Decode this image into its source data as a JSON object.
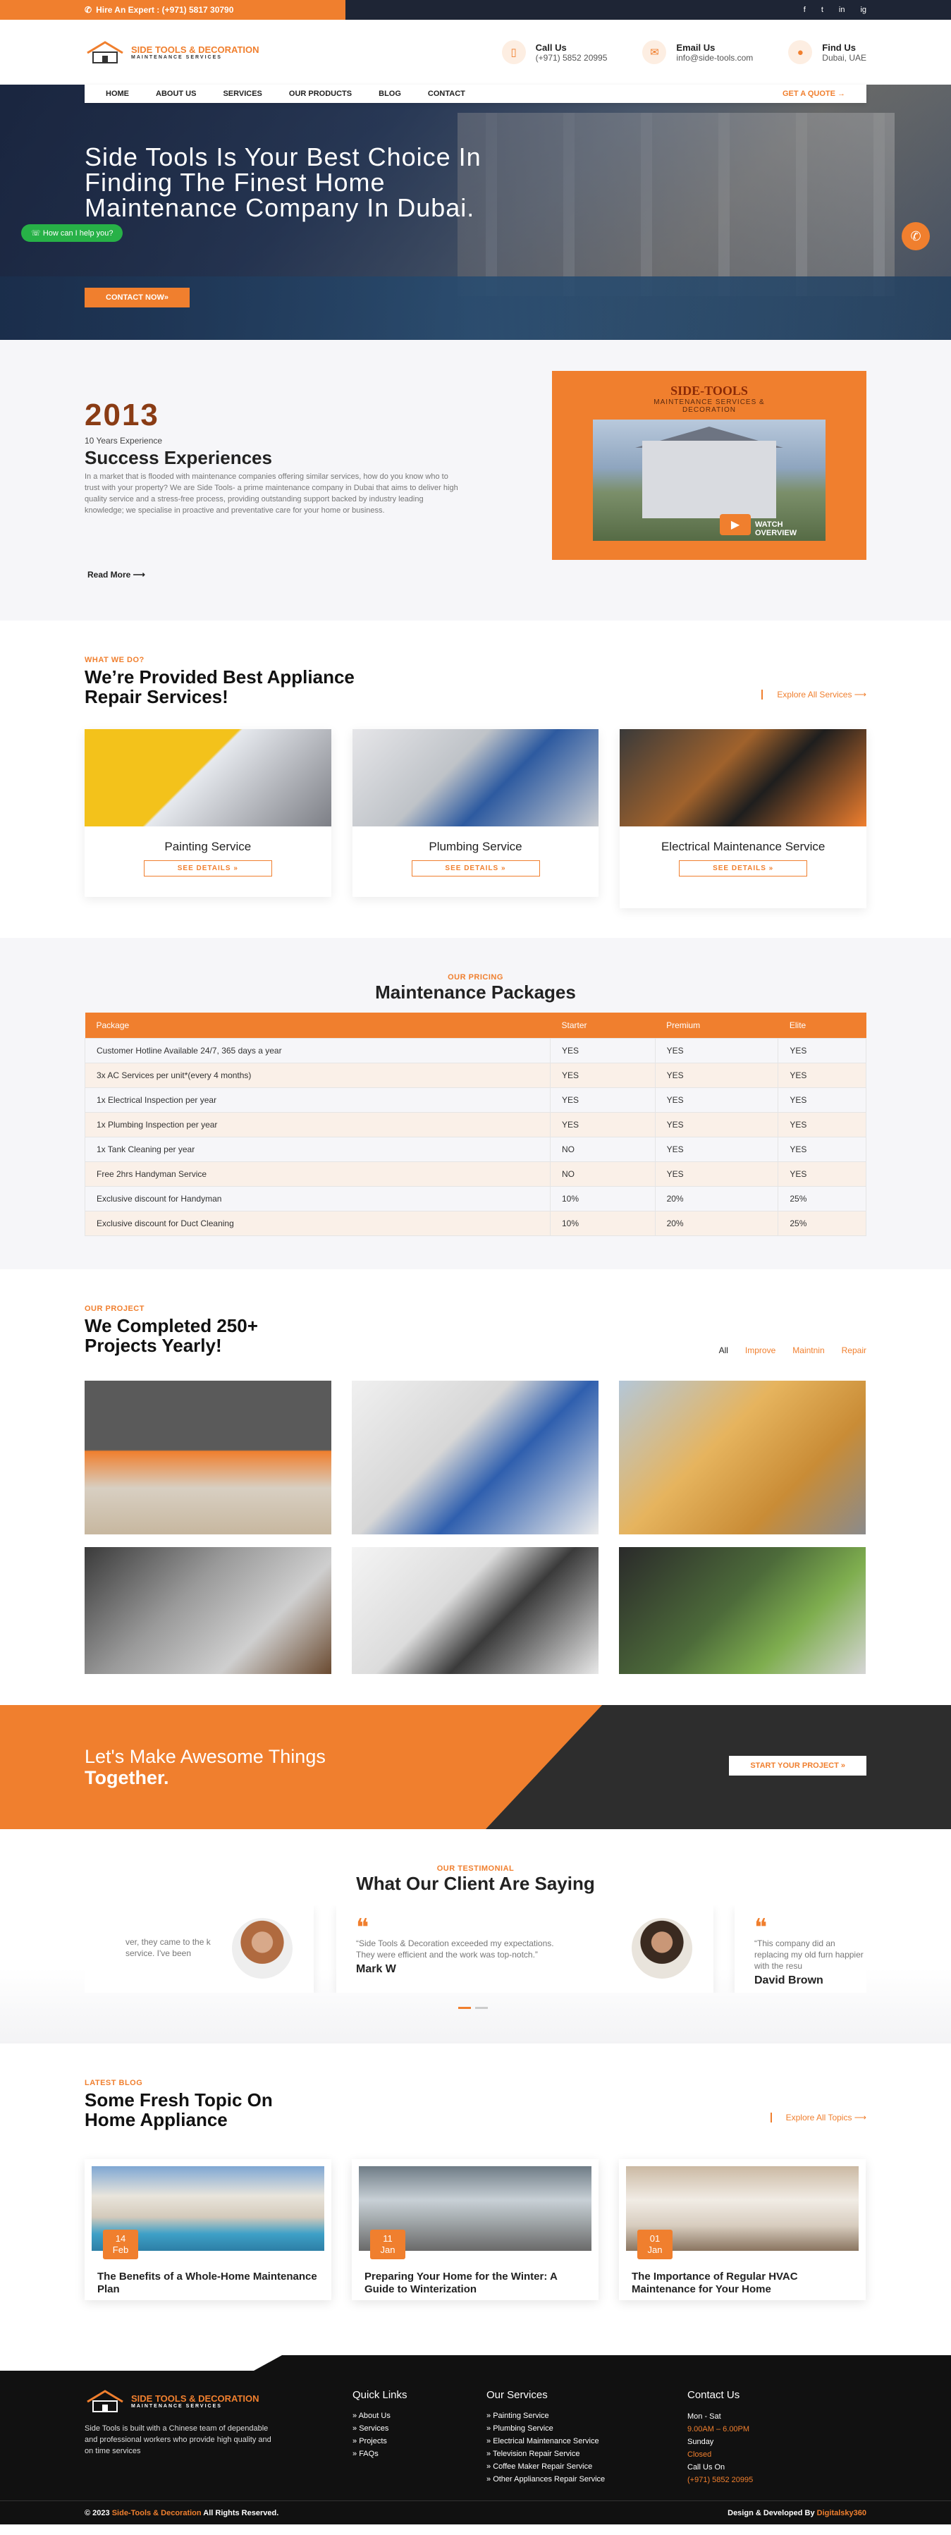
{
  "topbar": {
    "phone_label": "Hire An Expert : (+971) 5817 30790",
    "social": [
      "f",
      "t",
      "in",
      "ig"
    ]
  },
  "header": {
    "logo_title": "SIDE TOOLS & DECORATION",
    "logo_sub": "MAINTENANCE SERVICES",
    "call_title": "Call Us",
    "call_value": "(+971) 5852 20995",
    "email_title": "Email Us",
    "email_value": "info@side-tools.com",
    "find_title": "Find Us",
    "find_value": "Dubai, UAE"
  },
  "nav": {
    "items": [
      "HOME",
      "ABOUT US",
      "SERVICES",
      "OUR PRODUCTS",
      "BLOG",
      "CONTACT"
    ],
    "quote": "GET A QUOTE →"
  },
  "hero": {
    "heading": "Side Tools Is Your Best Choice In Finding The Finest Home Maintenance Company In Dubai.",
    "cta": "CONTACT NOW»",
    "whatsapp": "How can I help you?"
  },
  "about": {
    "year": "2013",
    "exp_label": "10 Years Experience",
    "heading": "Success Experiences",
    "desc": "In a market that is flooded with maintenance companies offering similar services, how do you know who to trust with your property? We are Side Tools- a prime maintenance company in Dubai that aims to deliver high quality service and a stress-free process, providing outstanding support backed by industry leading knowledge; we specialise in proactive and preventative care for your home or business.",
    "read_more": "Read More ⟶",
    "video_title": "SIDE-TOOLS",
    "video_sub": "MAINTENANCE SERVICES & DECORATION",
    "video_btn": "WATCH OVERVIEW"
  },
  "services": {
    "tag": "WHAT WE DO?",
    "heading_line1": "We’re Provided Best Appliance",
    "heading_line2": "Repair Services!",
    "explore": "Explore All Services ⟶",
    "cards": [
      {
        "title": "Painting Service",
        "btn": "SEE DETAILS »"
      },
      {
        "title": "Plumbing Service",
        "btn": "SEE DETAILS »"
      },
      {
        "title": "Electrical Maintenance Service",
        "btn": "SEE DETAILS »"
      }
    ]
  },
  "pricing": {
    "tag": "OUR PRICING",
    "heading": "Maintenance Packages",
    "headers": [
      "Package",
      "Starter",
      "Premium",
      "Elite"
    ],
    "rows": [
      [
        "Customer Hotline Available 24/7, 365 days a year",
        "YES",
        "YES",
        "YES"
      ],
      [
        "3x AC Services per unit*(every 4 months)",
        "YES",
        "YES",
        "YES"
      ],
      [
        "1x Electrical Inspection per year",
        "YES",
        "YES",
        "YES"
      ],
      [
        "1x Plumbing Inspection per year",
        "YES",
        "YES",
        "YES"
      ],
      [
        "1x Tank Cleaning per year",
        "NO",
        "YES",
        "YES"
      ],
      [
        "Free 2hrs Handyman Service",
        "NO",
        "YES",
        "YES"
      ],
      [
        "Exclusive discount for Handyman",
        "10%",
        "20%",
        "25%"
      ],
      [
        "Exclusive discount for Duct Cleaning",
        "10%",
        "20%",
        "25%"
      ]
    ]
  },
  "projects": {
    "tag": "OUR PROJECT",
    "heading_line1": "We Completed 250+",
    "heading_line2": "Projects Yearly!",
    "filters": [
      "All",
      "Improve",
      "Maintnin",
      "Repair"
    ]
  },
  "band": {
    "line1": "Let's Make Awesome Things",
    "line2": "Together.",
    "btn": "START YOUR PROJECT »"
  },
  "testimonials": {
    "tag": "OUR TESTIMONIAL",
    "heading": "What Our Client Are Saying",
    "items": [
      {
        "text": "ver, they came to the k service. I've been",
        "name": ""
      },
      {
        "text": "“Side Tools & Decoration exceeded my expectations. They were efficient and the work was top-notch.”",
        "name": "Mark W"
      },
      {
        "text": "“This company did an replacing my old furn happier with the resu",
        "name": "David Brown"
      }
    ]
  },
  "blog": {
    "tag": "LATEST BLOG",
    "heading_line1": "Some Fresh Topic On",
    "heading_line2": "Home Appliance",
    "explore": "Explore All Topics ⟶",
    "posts": [
      {
        "day": "14",
        "month": "Feb",
        "title": "The Benefits of a Whole-Home Maintenance Plan"
      },
      {
        "day": "11",
        "month": "Jan",
        "title": "Preparing Your Home for the Winter: A Guide to Winterization"
      },
      {
        "day": "01",
        "month": "Jan",
        "title": "The Importance of Regular HVAC Maintenance for Your Home"
      }
    ]
  },
  "footer": {
    "desc": "Side Tools is built with a Chinese team of dependable and professional workers who provide high quality and on time services",
    "quick_title": "Quick Links",
    "quick": [
      "About Us",
      "Services",
      "Projects",
      "FAQs"
    ],
    "services_title": "Our Services",
    "services": [
      "Painting Service",
      "Plumbing Service",
      "Electrical Maintenance Service",
      "Television Repair Service",
      "Coffee Maker Repair Service",
      "Other Appliances Repair Service"
    ],
    "contact_title": "Contact Us",
    "hours1": "Mon - Sat",
    "hours2": "9.00AM – 6.00PM",
    "sunday": "Sunday",
    "closed": "Closed",
    "call_label": "Call Us On",
    "call_value": "(+971) 5852 20995",
    "copyright_pre": "© 2023",
    "copyright_brand": "Side-Tools & Decoration",
    "copyright_post": "All Rights Reserved.",
    "dev_pre": "Design & Developed By",
    "dev_name": "Digitalsky360"
  }
}
